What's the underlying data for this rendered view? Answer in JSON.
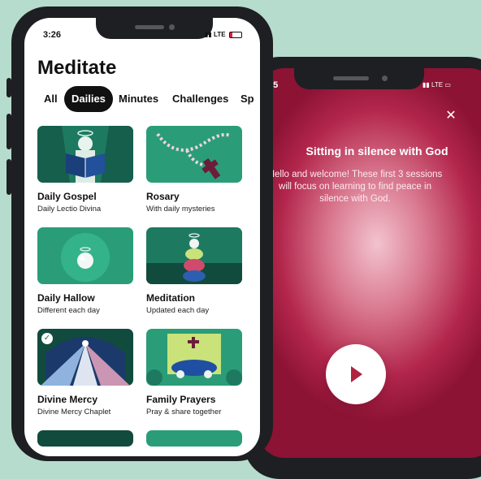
{
  "back_screen": {
    "time": "25",
    "status": "LTE",
    "title": "Sitting in silence with God",
    "description": "Hello and welcome! These first 3 sessions will focus on learning to find peace in silence with God.",
    "close_icon": "close-icon",
    "play_icon": "play-icon"
  },
  "front_screen": {
    "time": "3:26",
    "status": "LTE",
    "page_title": "Meditate",
    "tabs": [
      {
        "label": "All"
      },
      {
        "label": "Dailies",
        "active": true
      },
      {
        "label": "Minutes"
      },
      {
        "label": "Challenges"
      },
      {
        "label": "Sp"
      }
    ],
    "cards": [
      {
        "title": "Daily Gospel",
        "subtitle": "Daily Lectio Divina",
        "icon": "open-bible-icon"
      },
      {
        "title": "Rosary",
        "subtitle": "With daily mysteries",
        "icon": "rosary-icon"
      },
      {
        "title": "Daily Hallow",
        "subtitle": "Different each day",
        "icon": "halo-circle-icon"
      },
      {
        "title": "Meditation",
        "subtitle": "Updated each day",
        "icon": "stacked-stones-icon"
      },
      {
        "title": "Divine Mercy",
        "subtitle": "Divine Mercy Chaplet",
        "icon": "divine-mercy-rays-icon",
        "completed": true
      },
      {
        "title": "Family Prayers",
        "subtitle": "Pray & share together",
        "icon": "family-table-icon"
      }
    ]
  },
  "colors": {
    "background": "#b6dccd",
    "brand_green": "#2a9d78",
    "dark_green": "#114b3d",
    "player_magenta": "#b3264c"
  }
}
